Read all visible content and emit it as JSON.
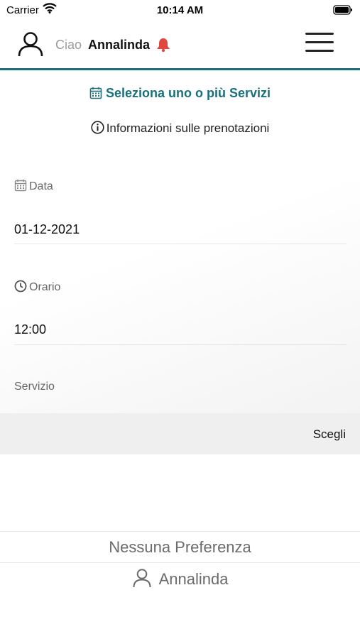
{
  "status_bar": {
    "carrier": "Carrier",
    "time": "10:14 AM"
  },
  "header": {
    "greeting": "Ciao",
    "user_name": "Annalinda"
  },
  "booking": {
    "title": "Seleziona uno o più Servizi",
    "info_link": "Informazioni sulle prenotazioni",
    "date_label": "Data",
    "date_value": "01-12-2021",
    "time_label": "Orario",
    "time_value": "12:00",
    "service_label": "Servizio",
    "choose_button": "Scegli"
  },
  "preferences": {
    "none_option": "Nessuna Preferenza",
    "user_option": "Annalinda"
  },
  "colors": {
    "accent": "#1b6f7a",
    "bell": "#e0473f"
  }
}
